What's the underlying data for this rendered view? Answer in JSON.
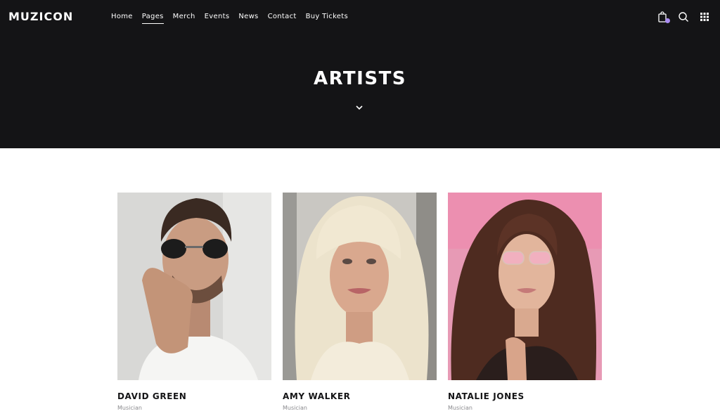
{
  "brand": {
    "logo": "MUZICON"
  },
  "nav": {
    "items": [
      {
        "label": "Home"
      },
      {
        "label": "Pages",
        "active": true
      },
      {
        "label": "Merch"
      },
      {
        "label": "Events"
      },
      {
        "label": "News"
      },
      {
        "label": "Contact"
      },
      {
        "label": "Buy Tickets"
      }
    ]
  },
  "header_icons": [
    "cart-icon",
    "search-icon",
    "grid-menu-icon"
  ],
  "hero": {
    "title": "ARTISTS",
    "scroll_icon": "chevron-down-icon"
  },
  "artists": [
    {
      "name": "DAVID GREEN",
      "role": "Musician"
    },
    {
      "name": "AMY WALKER",
      "role": "Musician"
    },
    {
      "name": "NATALIE JONES",
      "role": "Musician"
    }
  ],
  "colors": {
    "header_bg": "#141416",
    "page_bg": "#ffffff",
    "text_dark": "#141416",
    "text_muted": "#8a8a8e",
    "cart_badge": "#a98bf0"
  }
}
